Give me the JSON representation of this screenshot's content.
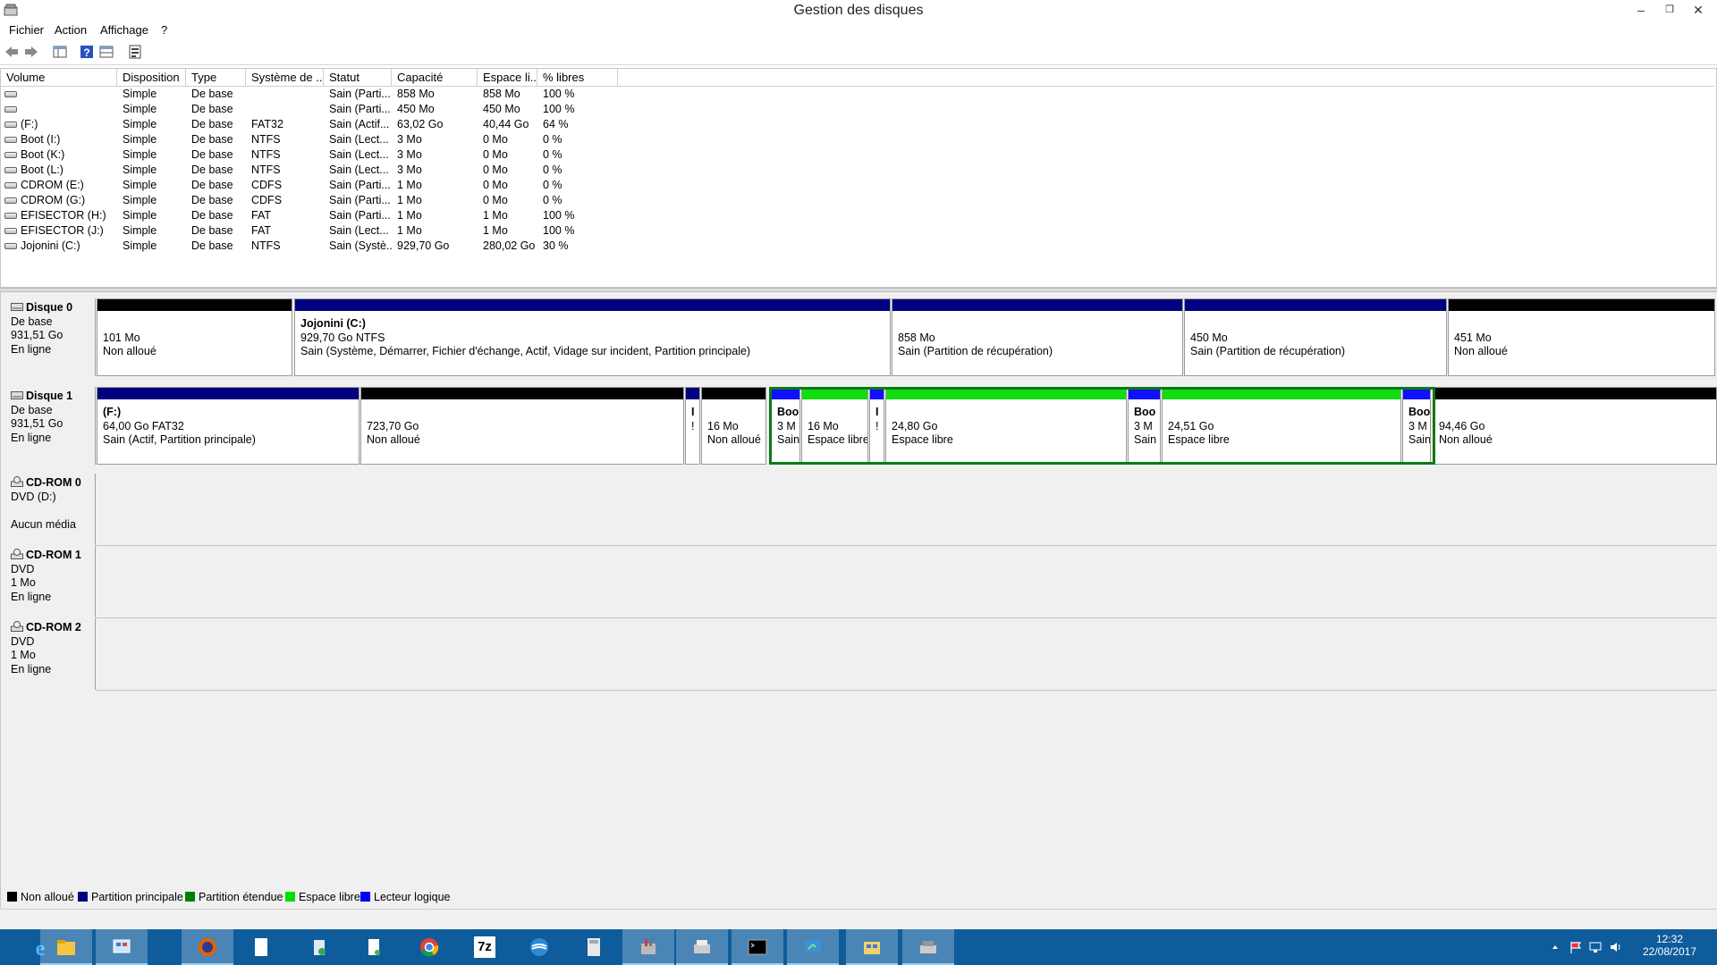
{
  "window": {
    "title": "Gestion des disques",
    "min_glyph": "–",
    "max_glyph": "❐",
    "close_glyph": "✕"
  },
  "menu": [
    "Fichier",
    "Action",
    "Affichage",
    "?"
  ],
  "toolbar_icons": [
    "back-arrow-icon",
    "forward-arrow-icon",
    "properties-icon",
    "help-icon",
    "view-icon",
    "settings-icon"
  ],
  "volume_table": {
    "columns": [
      "Volume",
      "Disposition",
      "Type",
      "Système de ...",
      "Statut",
      "Capacité",
      "Espace li...",
      "% libres"
    ],
    "rows": [
      [
        "",
        "Simple",
        "De base",
        "",
        "Sain (Parti...",
        "858 Mo",
        "858 Mo",
        "100 %"
      ],
      [
        "",
        "Simple",
        "De base",
        "",
        "Sain (Parti...",
        "450 Mo",
        "450 Mo",
        "100 %"
      ],
      [
        "(F:)",
        "Simple",
        "De base",
        "FAT32",
        "Sain (Actif...",
        "63,02 Go",
        "40,44 Go",
        "64 %"
      ],
      [
        "Boot (I:)",
        "Simple",
        "De base",
        "NTFS",
        "Sain (Lect...",
        "3 Mo",
        "0 Mo",
        "0 %"
      ],
      [
        "Boot (K:)",
        "Simple",
        "De base",
        "NTFS",
        "Sain (Lect...",
        "3 Mo",
        "0 Mo",
        "0 %"
      ],
      [
        "Boot (L:)",
        "Simple",
        "De base",
        "NTFS",
        "Sain (Lect...",
        "3 Mo",
        "0 Mo",
        "0 %"
      ],
      [
        "CDROM (E:)",
        "Simple",
        "De base",
        "CDFS",
        "Sain (Parti...",
        "1 Mo",
        "0 Mo",
        "0 %"
      ],
      [
        "CDROM (G:)",
        "Simple",
        "De base",
        "CDFS",
        "Sain (Parti...",
        "1 Mo",
        "0 Mo",
        "0 %"
      ],
      [
        "EFISECTOR (H:)",
        "Simple",
        "De base",
        "FAT",
        "Sain (Parti...",
        "1 Mo",
        "1 Mo",
        "100 %"
      ],
      [
        "EFISECTOR (J:)",
        "Simple",
        "De base",
        "FAT",
        "Sain (Lect...",
        "1 Mo",
        "1 Mo",
        "100 %"
      ],
      [
        "Jojonini (C:)",
        "Simple",
        "De base",
        "NTFS",
        "Sain (Systè...",
        "929,70 Go",
        "280,02 Go",
        "30 %"
      ]
    ]
  },
  "disks": [
    {
      "name": "Disque 0",
      "kind": "De base",
      "size": "931,51 Go",
      "state": "En ligne",
      "partitions": [
        {
          "name": "",
          "size": "101 Mo",
          "status": "Non alloué",
          "kind": "unallocated"
        },
        {
          "name": "Jojonini  (C:)",
          "size": "929,70 Go NTFS",
          "status": "Sain (Système, Démarrer, Fichier d'échange, Actif, Vidage sur incident, Partition principale)",
          "kind": "primary"
        },
        {
          "name": "",
          "size": "858 Mo",
          "status": "Sain (Partition de récupération)",
          "kind": "primary"
        },
        {
          "name": "",
          "size": "450 Mo",
          "status": "Sain (Partition de récupération)",
          "kind": "primary"
        },
        {
          "name": "",
          "size": "451 Mo",
          "status": "Non alloué",
          "kind": "unallocated"
        }
      ]
    },
    {
      "name": "Disque 1",
      "kind": "De base",
      "size": "931,51 Go",
      "state": "En ligne",
      "partitions": [
        {
          "name": "(F:)",
          "size": "64,00 Go FAT32",
          "status": "Sain (Actif, Partition principale)",
          "kind": "primary"
        },
        {
          "name": "",
          "size": "723,70 Go",
          "status": "Non alloué",
          "kind": "unallocated"
        },
        {
          "name": "I",
          "size": "!",
          "status": "",
          "kind": "primary"
        },
        {
          "name": "",
          "size": "16 Mo",
          "status": "Non alloué",
          "kind": "unallocated"
        },
        {
          "name": "Boo",
          "size": "3 M",
          "status": "Sain",
          "kind": "logical"
        },
        {
          "name": "",
          "size": "16 Mo",
          "status": "Espace libre",
          "kind": "free"
        },
        {
          "name": "I",
          "size": "!",
          "status": "",
          "kind": "logical"
        },
        {
          "name": "",
          "size": "24,80 Go",
          "status": "Espace libre",
          "kind": "free"
        },
        {
          "name": "Boo",
          "size": "3 M",
          "status": "Sain",
          "kind": "logical"
        },
        {
          "name": "",
          "size": "24,51 Go",
          "status": "Espace libre",
          "kind": "free"
        },
        {
          "name": "Boo",
          "size": "3 M",
          "status": "Sain",
          "kind": "logical"
        },
        {
          "name": "",
          "size": "94,46 Go",
          "status": "Non alloué",
          "kind": "unallocated"
        }
      ]
    }
  ],
  "cdroms": [
    {
      "name": "CD-ROM 0",
      "line1": "DVD (D:)",
      "line2": "",
      "line3": "Aucun média"
    },
    {
      "name": "CD-ROM 1",
      "line1": "DVD",
      "line2": "1 Mo",
      "line3": "En ligne"
    },
    {
      "name": "CD-ROM 2",
      "line1": "DVD",
      "line2": "1 Mo",
      "line3": "En ligne"
    }
  ],
  "legend": [
    {
      "label": "Non alloué",
      "color": "#000000"
    },
    {
      "label": "Partition principale",
      "color": "#000080"
    },
    {
      "label": "Partition étendue",
      "color": "#008000"
    },
    {
      "label": "Espace libre",
      "color": "#00e000"
    },
    {
      "label": "Lecteur logique",
      "color": "#0000ff"
    }
  ],
  "colors": {
    "unallocated": "#000000",
    "primary": "#000080",
    "logical": "#1010ff",
    "free": "#11dd11",
    "extended": "#0a7a14",
    "taskbar": "#0f5c9c"
  },
  "taskbar": {
    "apps": [
      "internet-explorer-icon",
      "file-explorer-icon",
      "control-panel-icon",
      "firefox-icon",
      "document-icon",
      "recycle-icon",
      "file-icon",
      "chrome-icon",
      "7zip-icon",
      "cloud-icon",
      "calculator-icon",
      "tools-icon",
      "printer-icon",
      "cmd-icon",
      "remote-icon",
      "network-icon",
      "disk-management-icon"
    ],
    "sevenzip_label": "7z",
    "time": "12:32",
    "date": "22/08/2017"
  }
}
